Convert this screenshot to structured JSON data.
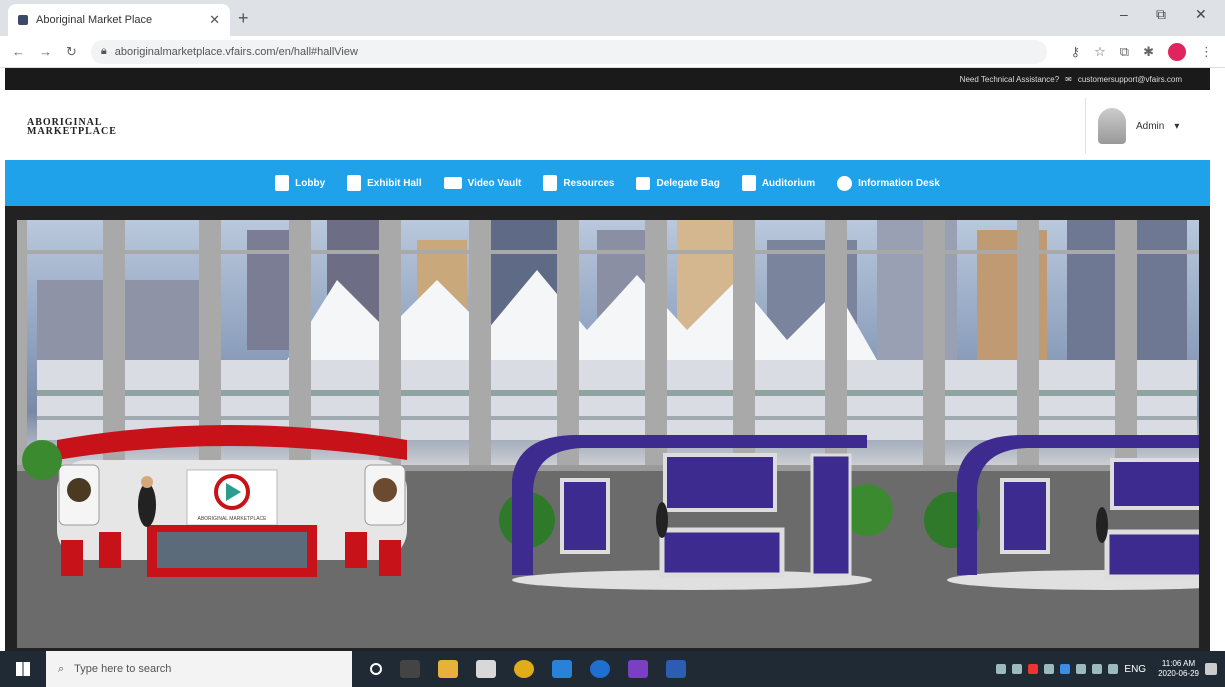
{
  "browser": {
    "tab_title": "Aboriginal Market Place",
    "url": "aboriginalmarketplace.vfairs.com/en/hall#hallView",
    "new_tab": "+",
    "close_tab": "✕",
    "window_controls": [
      "–",
      "⧉",
      "✕"
    ]
  },
  "site": {
    "topbar_text": "Need Technical Assistance?",
    "support_email": "customersupport@vfairs.com",
    "logo_line1": "ABORIGINAL",
    "logo_line2": "MARKETPLACE",
    "user_name": "Admin",
    "nav": [
      {
        "label": "Lobby",
        "icon": "lobby-icon"
      },
      {
        "label": "Exhibit Hall",
        "icon": "exhibit-hall-icon"
      },
      {
        "label": "Video Vault",
        "icon": "video-camera-icon"
      },
      {
        "label": "Resources",
        "icon": "resources-icon"
      },
      {
        "label": "Delegate Bag",
        "icon": "bag-icon"
      },
      {
        "label": "Auditorium",
        "icon": "auditorium-icon"
      },
      {
        "label": "Information Desk",
        "icon": "info-icon"
      }
    ],
    "booth_logo_text": "ABORIGINAL MARKETPLACE"
  },
  "taskbar": {
    "search_placeholder": "Type here to search",
    "lang": "ENG",
    "time": "11:06 AM",
    "date": "2020-06-29"
  },
  "colors": {
    "nav_bg": "#1fa2ea",
    "booth_purple": "#3d2b8f",
    "booth_red": "#c8121a"
  }
}
